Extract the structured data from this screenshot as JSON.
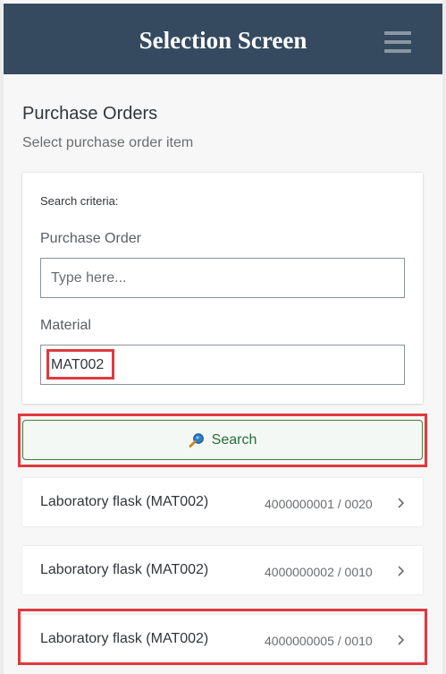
{
  "header": {
    "title": "Selection Screen",
    "menu_icon": "hamburger-icon"
  },
  "page": {
    "title": "Purchase Orders",
    "subtitle": "Select purchase order item"
  },
  "search_form": {
    "criteria_label": "Search criteria:",
    "purchase_order": {
      "label": "Purchase Order",
      "value": "",
      "placeholder": "Type here..."
    },
    "material": {
      "label": "Material",
      "value": "MAT002"
    }
  },
  "search_button": {
    "label": "Search",
    "icon": "search-icon"
  },
  "results": [
    {
      "name": "Laboratory flask (MAT002)",
      "number": "4000000001 / 0020"
    },
    {
      "name": "Laboratory flask (MAT002)",
      "number": "4000000002 / 0010"
    },
    {
      "name": "Laboratory flask (MAT002)",
      "number": "4000000005 / 0010"
    }
  ],
  "colors": {
    "header_bg": "#354a5f",
    "highlight": "#e0393e",
    "accept": "#256f3a"
  }
}
